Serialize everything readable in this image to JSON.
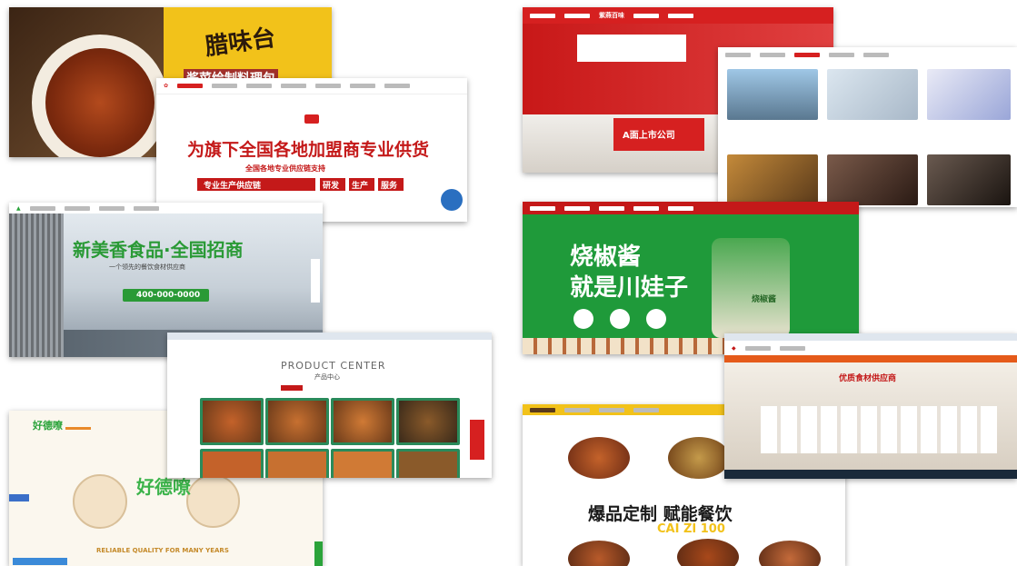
{
  "collage": {
    "card1": {
      "package_text": "腊味台",
      "sub_text": "酱菜绘制料理包"
    },
    "card2": {
      "headline": "为旗下全国各地加盟商专业供货",
      "sub_line": "全国各地专业供应链支持",
      "pills": [
        "专业生产供应链",
        "研发",
        "生产",
        "服务"
      ]
    },
    "card3": {
      "headline": "新美香食品·全国招商",
      "sub_line": "一个领先的餐饮食材供应商",
      "hotline": "400-000-0000"
    },
    "card4": {
      "title": "PRODUCT CENTER",
      "subtitle": "产品中心"
    },
    "card5": {
      "brand": "好德嘹",
      "tagline": "RELIABLE QUALITY FOR MANY YEARS"
    },
    "card6": {
      "sign_text": "A面上市公司",
      "logo": "紫燕百味"
    },
    "card8": {
      "headline_line1": "烧椒酱",
      "headline_line2": "就是川娃子",
      "jar_label": "烧椒酱"
    },
    "card9": {
      "headline": "爆品定制 赋能餐饮",
      "sub": "CAI ZI 100"
    },
    "card10": {
      "banner": "优质食材供应商"
    }
  }
}
